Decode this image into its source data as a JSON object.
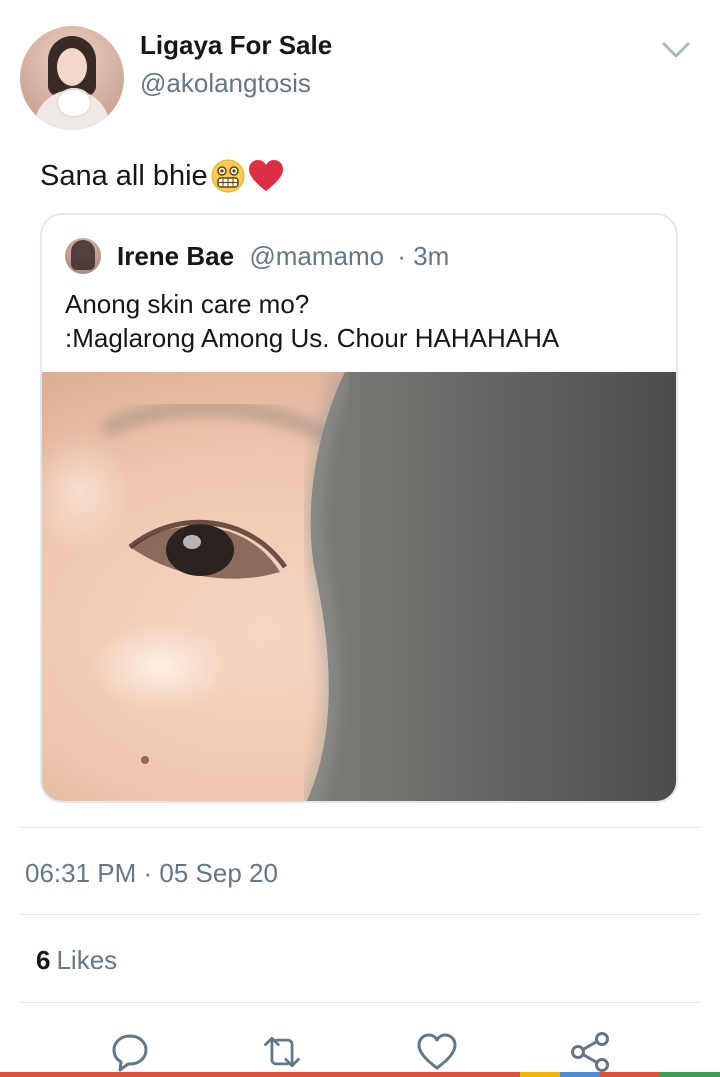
{
  "author": {
    "display_name": "Ligaya For Sale",
    "handle": "@akolangtosis"
  },
  "tweet": {
    "text": "Sana all bhie",
    "emojis": [
      "grimacing-face-icon",
      "red-heart-icon"
    ]
  },
  "quoted_tweet": {
    "display_name": "Irene Bae",
    "handle": "@mamamo",
    "time": "· 3m",
    "text_line1": "Anong skin care mo?",
    "text_line2": ":Maglarong Among Us. Chour HAHAHAHA"
  },
  "meta": {
    "timestamp": "06:31 PM · 05 Sep 20"
  },
  "stats": {
    "likes_count": "6",
    "likes_label": "Likes"
  },
  "actions": [
    "reply-icon",
    "retweet-icon",
    "like-icon",
    "share-icon"
  ],
  "colors": {
    "text": "#14171a",
    "secondary": "#657786",
    "border": "#e1e8ed",
    "heart": "#e0245e"
  }
}
